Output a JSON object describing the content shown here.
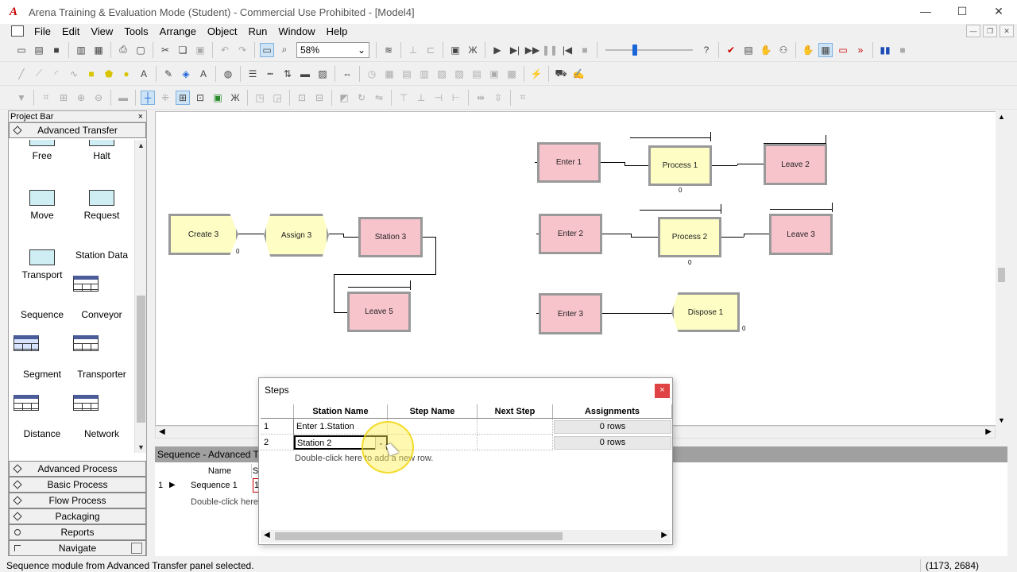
{
  "window": {
    "title": "Arena Training & Evaluation Mode (Student) - Commercial Use Prohibited - [Model4]",
    "minimize": "—",
    "maximize": "☐",
    "close": "✕"
  },
  "menu": [
    "File",
    "Edit",
    "View",
    "Tools",
    "Arrange",
    "Object",
    "Run",
    "Window",
    "Help"
  ],
  "toolbar": {
    "zoom_value": "58%"
  },
  "project_bar": {
    "title": "Project Bar",
    "close": "×",
    "active_panel": "Advanced Transfer",
    "modules": [
      {
        "label": "Free"
      },
      {
        "label": "Halt"
      },
      {
        "label": "Move"
      },
      {
        "label": "Request"
      },
      {
        "label": "Transport"
      },
      {
        "label": "Station Data"
      },
      {
        "label": "Sequence"
      },
      {
        "label": "Conveyor"
      },
      {
        "label": "Segment"
      },
      {
        "label": "Transporter"
      },
      {
        "label": "Distance"
      },
      {
        "label": "Network"
      }
    ],
    "panels": [
      "Advanced Process",
      "Basic Process",
      "Flow Process",
      "Packaging",
      "Reports",
      "Navigate"
    ]
  },
  "model": {
    "nodes": {
      "create3": "Create 3",
      "assign3": "Assign 3",
      "station3": "Station 3",
      "leave5": "Leave 5",
      "enter1": "Enter 1",
      "process1": "Process 1",
      "leave2": "Leave 2",
      "enter2": "Enter 2",
      "process2": "Process 2",
      "leave3": "Leave 3",
      "enter3": "Enter 3",
      "dispose1": "Dispose 1"
    },
    "counters": {
      "create3": "0",
      "process1": "0",
      "process2": "0",
      "dispose1": "0"
    }
  },
  "sheet": {
    "title": "Sequence - Advanced Transfer",
    "columns": [
      "Name",
      "S"
    ],
    "rows": [
      {
        "num": "1",
        "name": "Sequence 1",
        "steps": "1"
      }
    ],
    "hint": "Double-click here"
  },
  "steps_dialog": {
    "title": "Steps",
    "close": "×",
    "columns": [
      "Station Name",
      "Step Name",
      "Next Step",
      "Assignments"
    ],
    "rows": [
      {
        "num": "1",
        "station": "Enter 1.Station",
        "step": "",
        "next": "",
        "assignments": "0 rows"
      },
      {
        "num": "2",
        "station": "Station 2",
        "step": "",
        "next": "",
        "assignments": "0 rows"
      }
    ],
    "hint": "Double-click here to add a new row."
  },
  "status": {
    "message": "Sequence module from Advanced Transfer panel selected.",
    "coords": "(1173, 2684)"
  },
  "colors": {
    "station_fill": "#f8c4cc",
    "process_fill": "#fdfdc4",
    "close_red": "#e04343"
  }
}
